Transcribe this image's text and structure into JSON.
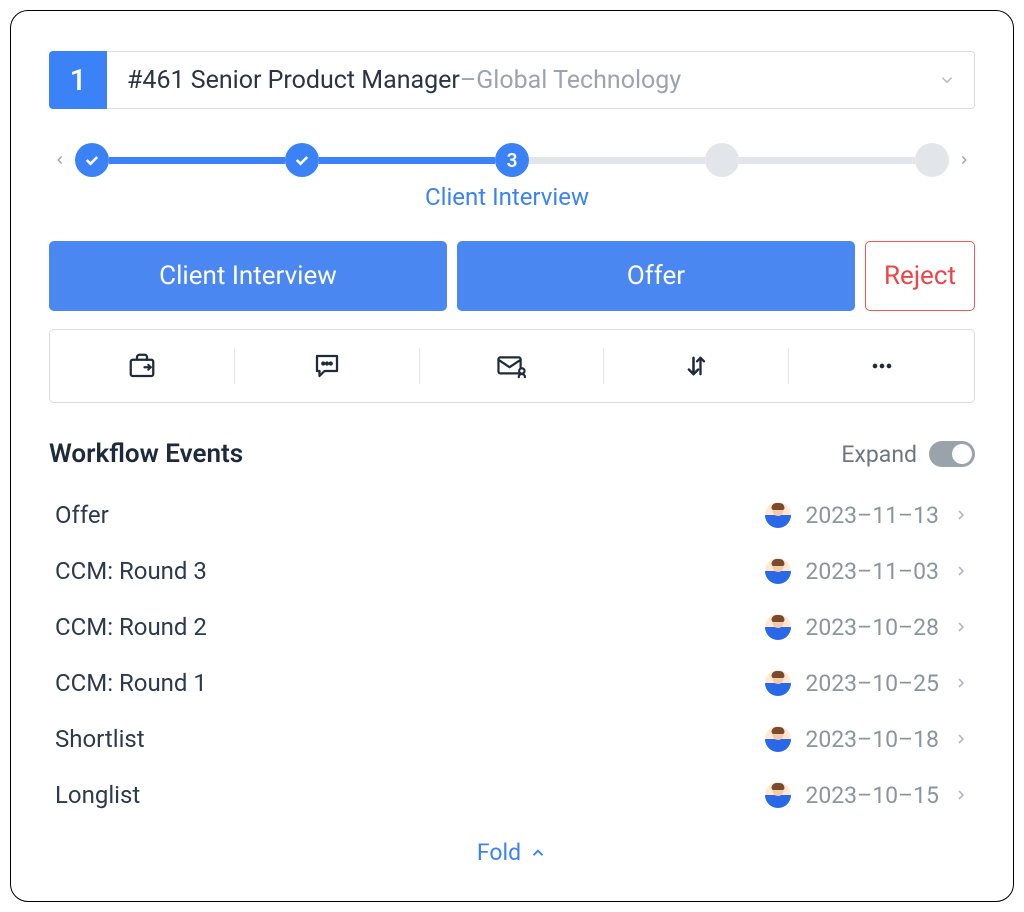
{
  "header": {
    "number": "1",
    "title_main": "#461 Senior Product Manager",
    "title_sep": " – ",
    "title_sub": "Global Technology"
  },
  "stepper": {
    "current_label": "Client Interview",
    "current_index_label": "3"
  },
  "actions": {
    "primary1": "Client Interview",
    "primary2": "Offer",
    "reject": "Reject"
  },
  "toolbar_icons": [
    "briefcase",
    "comment",
    "mail-user",
    "sort",
    "more"
  ],
  "workflow": {
    "title": "Workflow Events",
    "expand_label": "Expand",
    "events": [
      {
        "name": "Offer",
        "date": "2023–11–13"
      },
      {
        "name": "CCM: Round 3",
        "date": "2023–11–03"
      },
      {
        "name": "CCM: Round 2",
        "date": "2023–10–28"
      },
      {
        "name": "CCM: Round 1",
        "date": "2023–10–25"
      },
      {
        "name": "Shortlist",
        "date": "2023–10–18"
      },
      {
        "name": "Longlist",
        "date": "2023–10–15"
      }
    ],
    "fold_label": "Fold"
  }
}
